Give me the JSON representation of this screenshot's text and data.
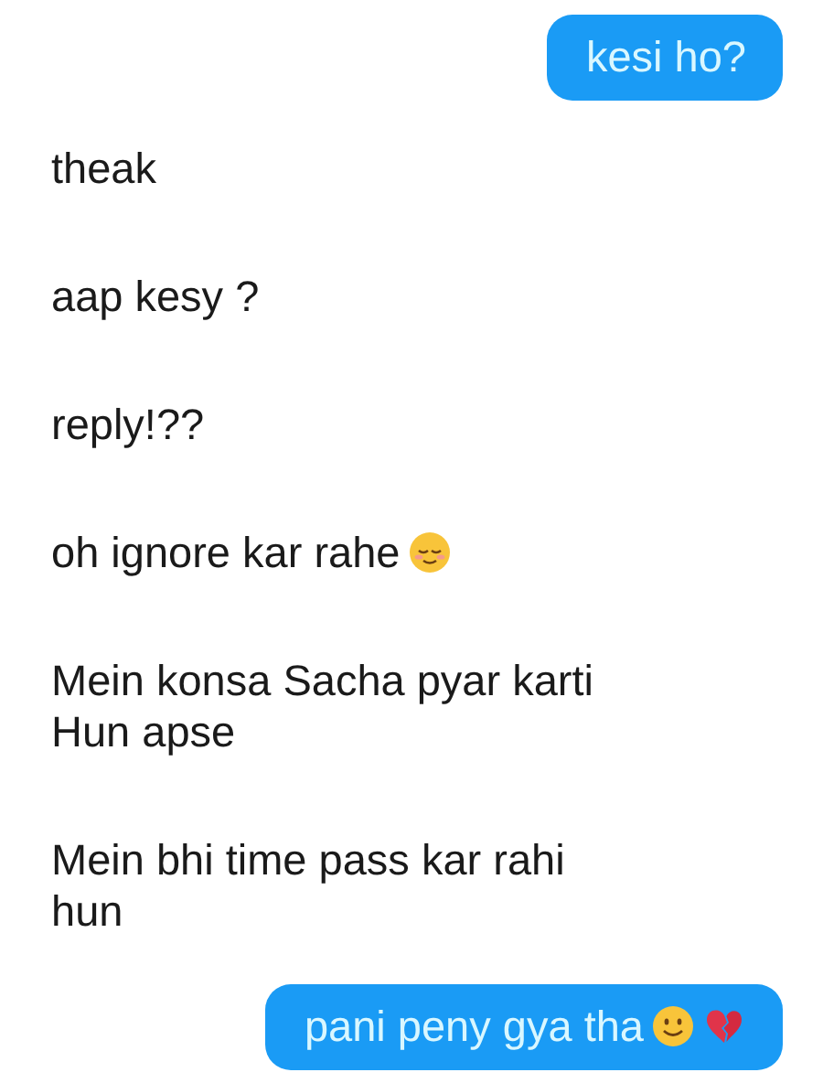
{
  "messages": [
    {
      "kind": "sent",
      "text": "kesi ho?"
    },
    {
      "kind": "received",
      "text": "theak"
    },
    {
      "kind": "received",
      "text": "aap kesy ?"
    },
    {
      "kind": "received",
      "text": "reply!??"
    },
    {
      "kind": "received",
      "text": "oh ignore kar rahe",
      "emojis": [
        {
          "kind": "relieved-face"
        }
      ]
    },
    {
      "kind": "received",
      "text": "Mein konsa Sacha pyar karti Hun apse"
    },
    {
      "kind": "received",
      "text": "Mein bhi time pass kar rahi hun"
    },
    {
      "kind": "sent",
      "text": "pani peny gya tha",
      "emojis": [
        {
          "kind": "smiling-face"
        },
        {
          "kind": "broken-heart"
        }
      ]
    }
  ]
}
